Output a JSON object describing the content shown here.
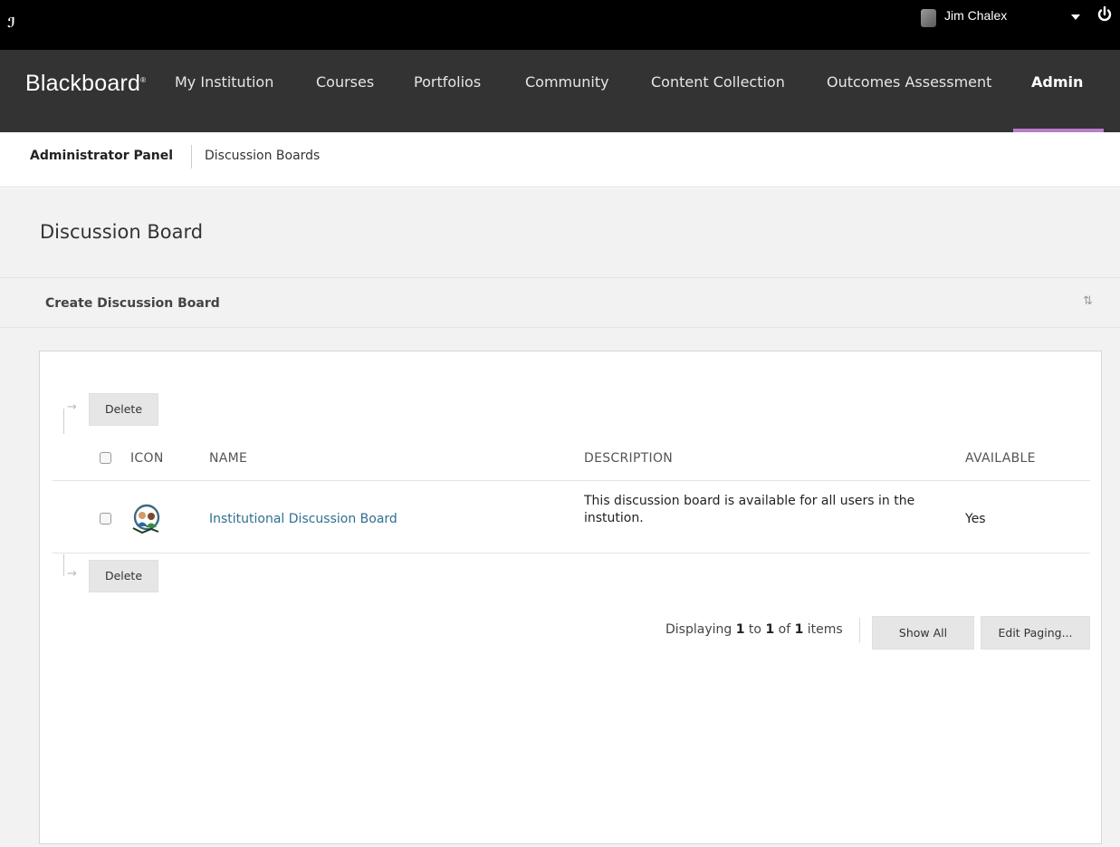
{
  "topbar": {
    "user_name": "Jim Chalex"
  },
  "nav": {
    "brand": "Blackboard",
    "brand_mark": "®",
    "items": [
      {
        "label": "My Institution"
      },
      {
        "label": "Courses"
      },
      {
        "label": "Portfolios"
      },
      {
        "label": "Community"
      },
      {
        "label": "Content Collection"
      },
      {
        "label": "Outcomes Assessment"
      },
      {
        "label": "Admin"
      }
    ],
    "active_item": "Admin",
    "accent_color": "#b77ec9"
  },
  "breadcrumb": {
    "root": "Administrator Panel",
    "current": "Discussion Boards"
  },
  "page": {
    "title": "Discussion Board",
    "create_label": "Create Discussion Board",
    "sort_icon": "sort-arrows-icon"
  },
  "table": {
    "delete_label": "Delete",
    "columns": [
      "ICON",
      "NAME",
      "DESCRIPTION",
      "AVAILABLE"
    ],
    "rows": [
      {
        "icon": "discussion-board-icon",
        "name": "Institutional Discussion Board",
        "description": "This discussion board is available for all users in the instution.",
        "available": "Yes"
      }
    ]
  },
  "paging": {
    "prefix": "Displaying",
    "from": "1",
    "to_word": "to",
    "to": "1",
    "of_word": "of",
    "total": "1",
    "suffix": "items",
    "show_all_label": "Show All",
    "edit_paging_label": "Edit Paging..."
  }
}
